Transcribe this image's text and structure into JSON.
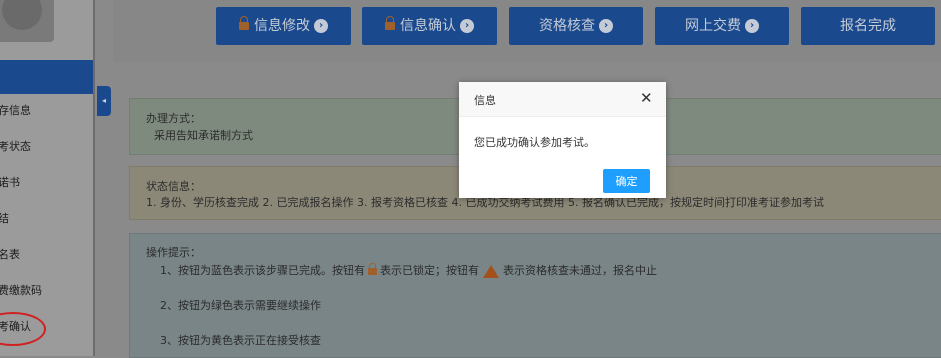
{
  "sidebar": {
    "items": [
      {
        "label": "存信息"
      },
      {
        "label": "考状态"
      },
      {
        "label": "诺书"
      },
      {
        "label": "结"
      },
      {
        "label": "名表"
      },
      {
        "label": "费缴款码"
      },
      {
        "label": "考确认"
      }
    ]
  },
  "steps": [
    {
      "label": "信息修改",
      "locked": true
    },
    {
      "label": "信息确认",
      "locked": true
    },
    {
      "label": "资格核查",
      "locked": false
    },
    {
      "label": "网上交费",
      "locked": false
    },
    {
      "label": "报名完成",
      "locked": false
    }
  ],
  "panels": {
    "method": {
      "title": "办理方式：",
      "text": "采用告知承诺制方式"
    },
    "status": {
      "title": "状态信息：",
      "text": "1. 身份、学历核查完成 2. 已完成报名操作 3. 报考资格已核查 4. 已成功交纳考试费用 5. 报名确认已完成，按规定时间打印准考证参加考试"
    },
    "tips": {
      "title": "操作提示：",
      "line1_a": "1、按钮为蓝色表示该步骤已完成。按钮有",
      "line1_b": "表示已锁定；按钮有",
      "line1_c": "表示资格核查未通过，报名中止",
      "line2": "2、按钮为绿色表示需要继续操作",
      "line3": "3、按钮为黄色表示正在接受核查"
    }
  },
  "dialog": {
    "title": "信息",
    "close": "✕",
    "message": "您已成功确认参加考试。",
    "ok": "确定"
  },
  "colors": {
    "step_blue": "#1a4a8d",
    "ok_blue": "#1e9fff",
    "circle_red": "#d02020"
  }
}
